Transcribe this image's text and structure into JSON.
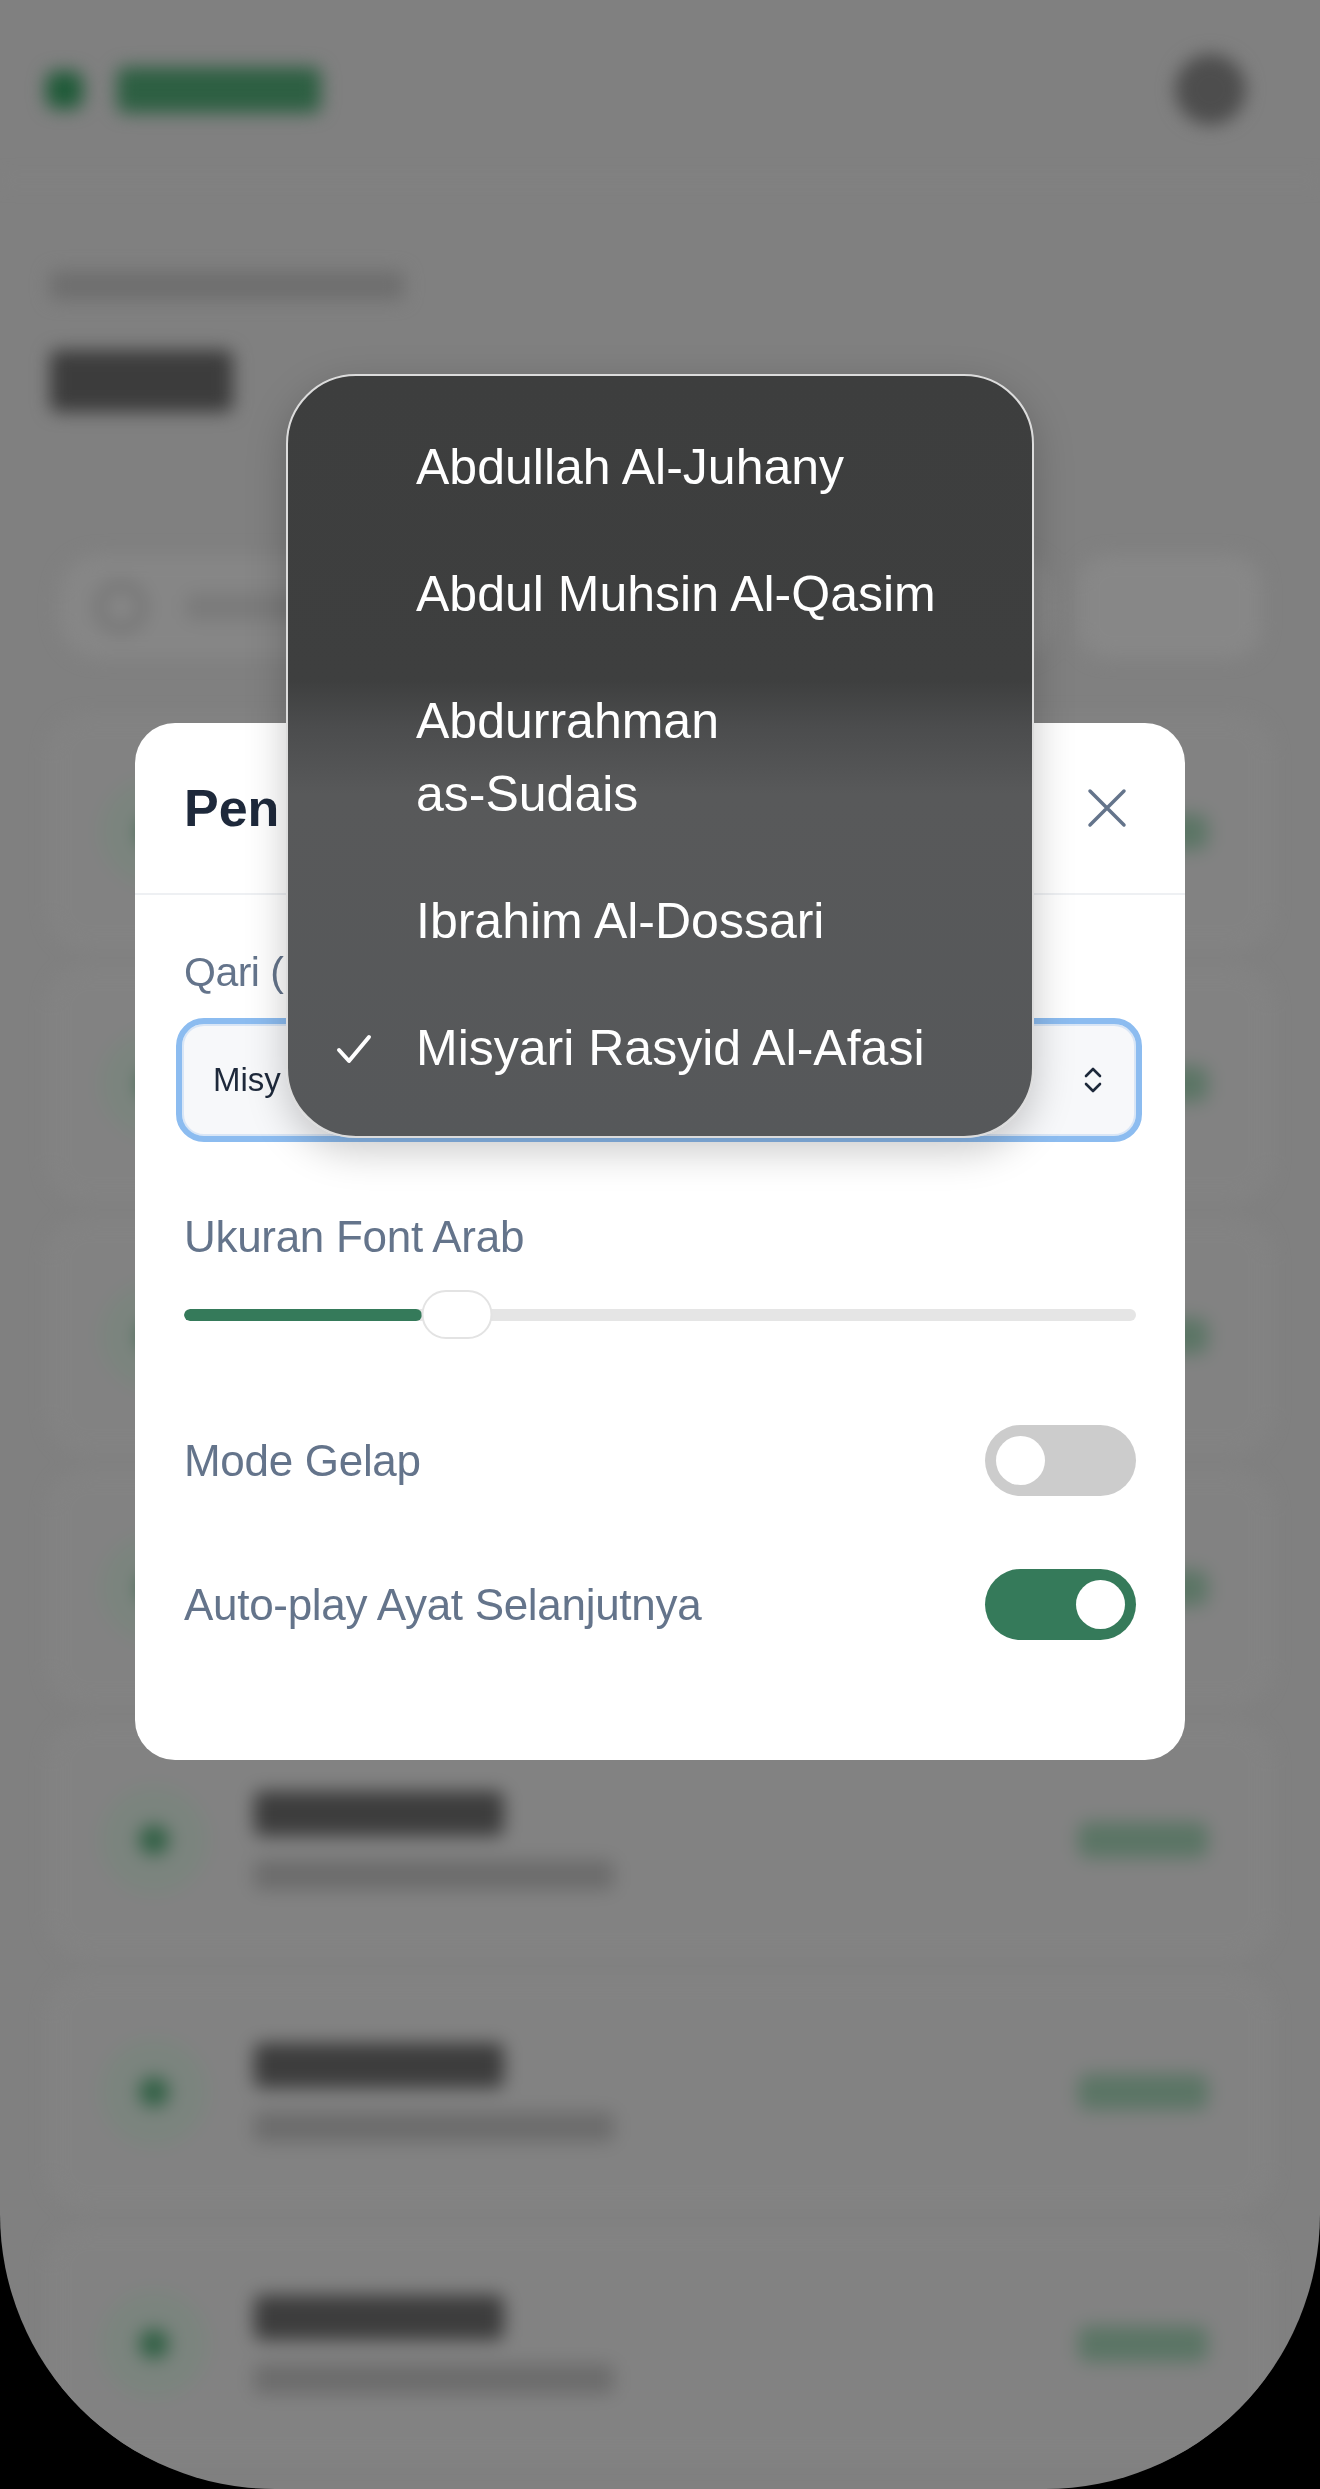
{
  "dialog": {
    "title": "Pen",
    "settings": [
      {
        "kind": "select",
        "label": "Qari (",
        "value": "Misy",
        "focused": true
      },
      {
        "kind": "slider",
        "label": "Ukuran Font Arab",
        "level": 0.27
      },
      {
        "kind": "toggle",
        "label": "Mode Gelap",
        "on": false
      },
      {
        "kind": "toggle",
        "label": "Auto-play Ayat Selanjutnya",
        "on": true
      }
    ]
  },
  "qari_menu": {
    "options": [
      {
        "label": "Abdullah Al-Juhany",
        "selected": false
      },
      {
        "label": "Abdul Muhsin Al-Qasim",
        "selected": false
      },
      {
        "label": "Abdurrahman as-Sudais",
        "selected": false
      },
      {
        "label": "Ibrahim Al-Dossari",
        "selected": false
      },
      {
        "label": "Misyari Rasyid Al-Afasi",
        "selected": true
      }
    ]
  }
}
